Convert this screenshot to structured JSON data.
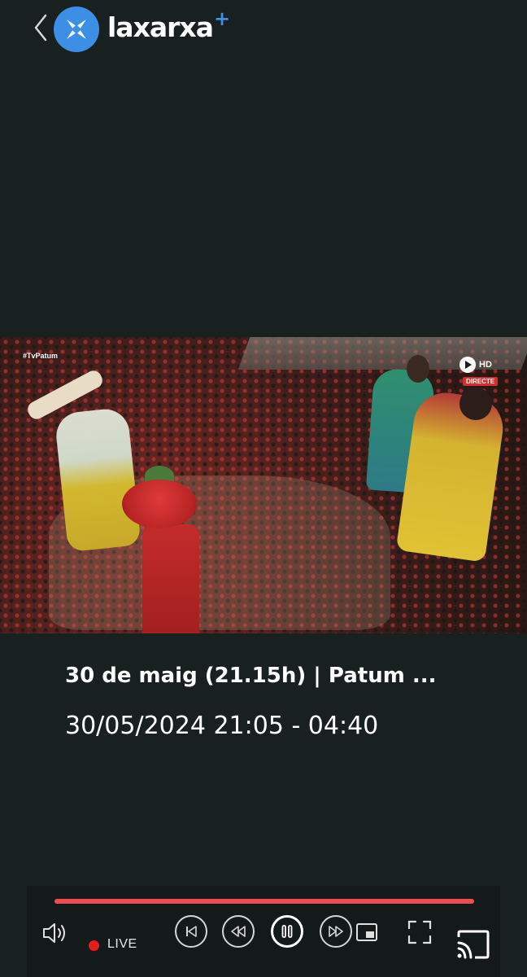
{
  "header": {
    "back_icon": "chevron-left-icon",
    "logo_icon": "star-x-logo-icon",
    "logo_text": "laxarxa",
    "logo_plus": "+",
    "brand_color": "#3d8fe6"
  },
  "video": {
    "hashtag": "#TvPatum",
    "channel_icon": "play-circle-icon",
    "quality_label": "HD",
    "live_badge": "DIRECTE"
  },
  "program": {
    "title": "30 de maig (21.15h) | Patum ...",
    "time_range": "30/05/2024 21:05 - 04:40"
  },
  "player": {
    "progress_fraction": 1.0,
    "progress_color": "#ef4d4d",
    "live_label": "LIVE",
    "live_color": "#e41e1e",
    "icons": {
      "volume": "speaker-icon",
      "skip_previous": "skip-previous-icon",
      "rewind": "rewind-icon",
      "pause": "pause-icon",
      "fast_forward": "fast-forward-icon",
      "picture_in_picture": "picture-in-picture-icon",
      "fullscreen": "fullscreen-icon",
      "cast": "cast-icon"
    }
  }
}
